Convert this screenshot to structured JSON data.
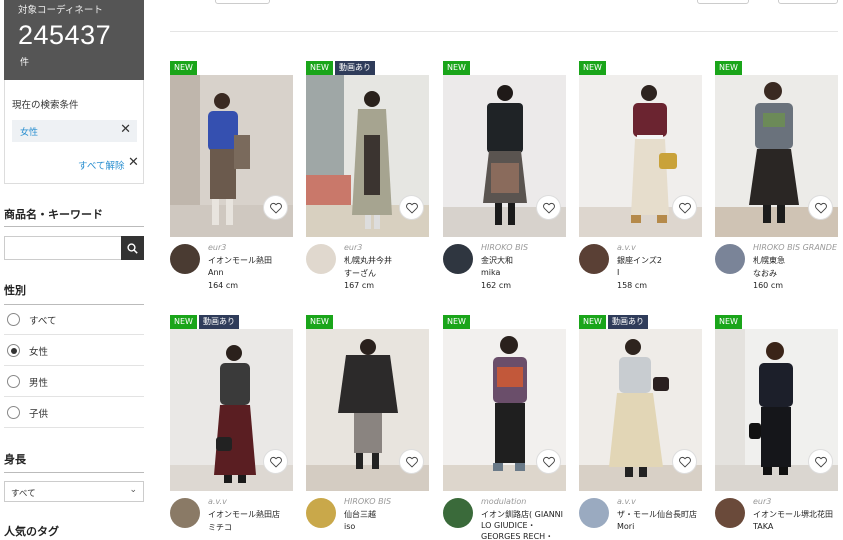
{
  "summary": {
    "count_label": "対象コーディネート",
    "count": "245437",
    "count_unit": "件"
  },
  "conditions": {
    "title": "現在の検索条件",
    "chips": [
      "女性"
    ],
    "clear_all": "すべて解除"
  },
  "keyword": {
    "title": "商品名・キーワード",
    "placeholder": ""
  },
  "gender": {
    "title": "性別",
    "options": [
      "すべて",
      "女性",
      "男性",
      "子供"
    ],
    "selected": "女性"
  },
  "height_filter": {
    "title": "身長",
    "value": "すべて"
  },
  "tags_section": {
    "title": "人気のタグ"
  },
  "badges": {
    "new": "NEW",
    "video": "動画あり"
  },
  "cards": [
    {
      "brand": "eur3",
      "shop": "イオンモール熱田",
      "staff": "Ann",
      "height": "164 cm",
      "video": false
    },
    {
      "brand": "eur3",
      "shop": "札幌丸井今井",
      "staff": "すーざん",
      "height": "167 cm",
      "video": true
    },
    {
      "brand": "HIROKO BIS",
      "shop": "金沢大和",
      "staff": "mika",
      "height": "162 cm",
      "video": false
    },
    {
      "brand": "a.v.v",
      "shop": "銀座インズ2",
      "staff": "I",
      "height": "158 cm",
      "video": false
    },
    {
      "brand": "HIROKO BIS GRANDE",
      "shop": "札幌東急",
      "staff": "なおみ",
      "height": "160 cm",
      "video": false
    },
    {
      "brand": "a.v.v",
      "shop": "イオンモール熱田店",
      "staff": "ミチコ",
      "height": "",
      "video": true
    },
    {
      "brand": "HIROKO BIS",
      "shop": "仙台三越",
      "staff": "iso",
      "height": "",
      "video": false
    },
    {
      "brand": "modulation",
      "shop": "イオン釧路店( GIANNI LO GIUDICE・GEORGES RECH・",
      "staff": "",
      "height": "",
      "video": false
    },
    {
      "brand": "a.v.v",
      "shop": "ザ・モール仙台長町店",
      "staff": "Mori",
      "height": "",
      "video": true
    },
    {
      "brand": "eur3",
      "shop": "イオンモール堺北花田",
      "staff": "TAKA",
      "height": "",
      "video": false
    }
  ],
  "colors": {
    "new_badge": "#1aa51a",
    "video_badge": "#2f3c5a",
    "link_blue": "#2a8fd0",
    "count_bg": "#555555"
  },
  "icons": {
    "favorite": "heart-outline-icon",
    "search": "magnifier-icon",
    "remove": "close-icon",
    "select": "chevron-down-icon"
  }
}
